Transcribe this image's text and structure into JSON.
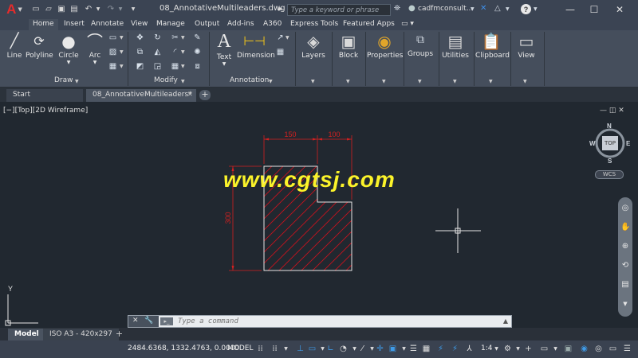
{
  "titlebar": {
    "logo": "A",
    "doc_title": "08_AnnotativeMultileaders.dwg",
    "search_placeholder": "Type a keyword or phrase",
    "user": "cadfmconsult..."
  },
  "ribbon_tabs": [
    "Home",
    "Insert",
    "Annotate",
    "View",
    "Manage",
    "Output",
    "Add-ins",
    "A360",
    "Express Tools",
    "Featured Apps"
  ],
  "ribbon": {
    "draw": {
      "title": "Draw",
      "buttons": [
        "Line",
        "Polyline",
        "Circle",
        "Arc"
      ]
    },
    "modify": {
      "title": "Modify"
    },
    "annotation": {
      "title": "Annotation",
      "buttons": [
        "Text",
        "Dimension"
      ]
    },
    "big_buttons": [
      "Layers",
      "Block",
      "Properties",
      "Groups",
      "Utilities",
      "Clipboard",
      "View"
    ]
  },
  "doc_tabs": [
    "Start",
    "08_AnnotativeMultileaders*"
  ],
  "viewport_label": "[−][Top][2D Wireframe]",
  "viewcube": {
    "top": "TOP",
    "n": "N",
    "s": "S",
    "e": "E",
    "w": "W",
    "wcs": "WCS"
  },
  "drawing": {
    "dim_top_left": "150",
    "dim_top_right": "100",
    "dim_left": "300",
    "line_color": "#e6e6e6",
    "dim_color": "#d42020",
    "hatch_color": "#c8141e"
  },
  "ucs": {
    "y_label": "Y"
  },
  "watermark": "www.cgtsj.com",
  "command": {
    "placeholder": "Type a command"
  },
  "layout_tabs": [
    "Model",
    "ISO A3 - 420x297"
  ],
  "status": {
    "coords": "2484.6368, 1332.4763, 0.0000",
    "model": "MODEL",
    "scale": "1:4"
  }
}
